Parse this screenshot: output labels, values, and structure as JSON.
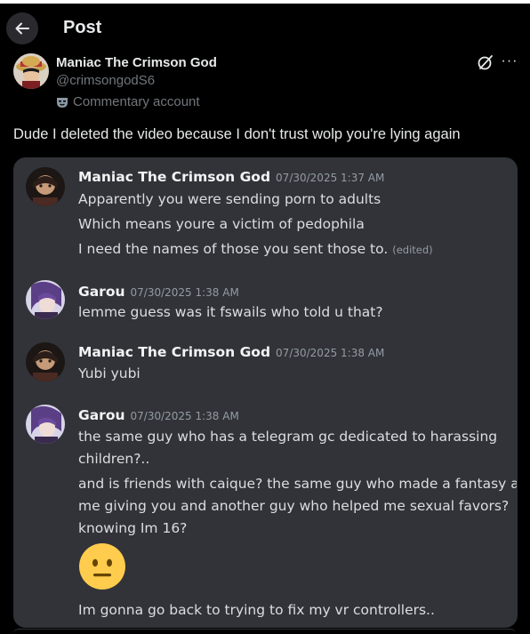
{
  "header": {
    "title": "Post",
    "back_icon": "arrow-left-icon"
  },
  "author": {
    "name": "Maniac The Crimson God",
    "handle": "@crimsongodS6",
    "label": "Commentary account",
    "label_icon": "mask-icon"
  },
  "post": {
    "text": "Dude I deleted the video because I don't trust wolp you're lying again"
  },
  "messages": [
    {
      "author": "Maniac The Crimson God",
      "timestamp": "07/30/2025 1:37 AM",
      "lines": [
        "Apparently you were sending porn to adults",
        "Which means youre a victim of pedophila",
        "I need the names of those you sent those to."
      ],
      "edited_label": "(edited)"
    },
    {
      "author": "Garou",
      "timestamp": "07/30/2025 1:38 AM",
      "lines": [
        "lemme guess was it fswails who told u that?"
      ]
    },
    {
      "author": "Maniac The Crimson God",
      "timestamp": "07/30/2025 1:38 AM",
      "lines": [
        "Yubi yubi"
      ]
    },
    {
      "author": "Garou",
      "timestamp": "07/30/2025 1:38 AM",
      "lines": [
        "the same guy who has a telegram gc dedicated to harassing",
        "children?..",
        "and is friends with caique? the same guy who made a fantasy abt",
        "me giving you and another guy who helped me sexual favors?",
        "knowing Im 16?",
        "Im gonna go back to trying to fix my vr controllers.."
      ],
      "emoji": "neutral-face-icon"
    }
  ],
  "colors": {
    "background": "#000000",
    "card": "#313338",
    "text": "#e7e9ea",
    "muted": "#71767b",
    "emoji": "#ffcc4d"
  }
}
